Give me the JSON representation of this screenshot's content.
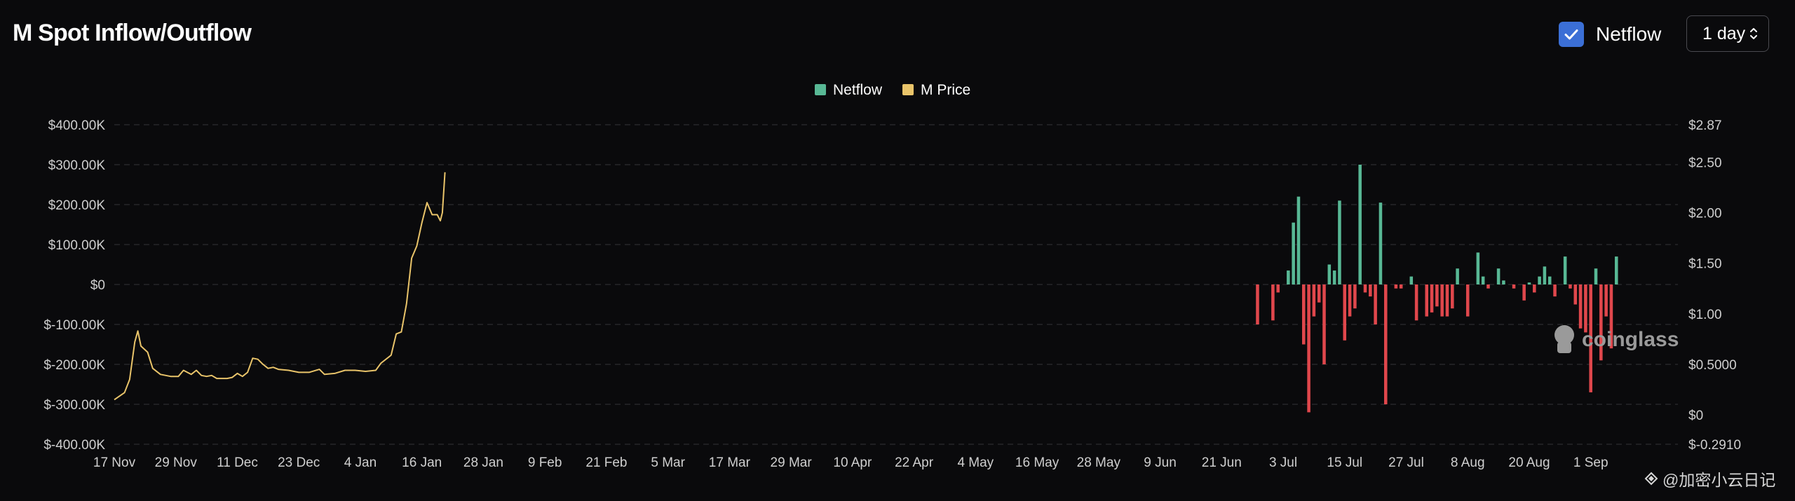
{
  "header": {
    "title": "M Spot Inflow/Outflow",
    "netflow_toggle": {
      "label": "Netflow",
      "checked": true
    },
    "interval_select": {
      "value": "1 day"
    }
  },
  "watermark": {
    "logo_text": "coinglass",
    "source": "@加密小云日记"
  },
  "colors": {
    "background": "#0a0a0c",
    "netflow_positive": "#58b895",
    "netflow_negative": "#e0474c",
    "price": "#e9c46a",
    "grid": "#2c2c30",
    "axis_text": "#cfcfcf"
  },
  "chart_data": {
    "type": "bar",
    "legend": [
      {
        "name": "Netflow",
        "color": "#58b895"
      },
      {
        "name": "M Price",
        "color": "#e9c46a"
      }
    ],
    "legend_position": "top-center",
    "grid": true,
    "y_left": {
      "ticks": [
        "$400.00K",
        "$300.00K",
        "$200.00K",
        "$100.00K",
        "$0",
        "$-100.00K",
        "$-200.00K",
        "$-300.00K",
        "$-400.00K"
      ],
      "range": [
        -400000,
        400000
      ]
    },
    "y_right": {
      "ticks": [
        "$2.87",
        "$2.50",
        "$2.00",
        "$1.50",
        "$1.00",
        "$0.5000",
        "$0",
        "$-0.2910"
      ],
      "tick_values": [
        2.87,
        2.5,
        2.0,
        1.5,
        1.0,
        0.5,
        0,
        -0.291
      ],
      "range": [
        -0.291,
        2.87
      ]
    },
    "x_ticks": [
      "17 Nov",
      "29 Nov",
      "11 Dec",
      "23 Dec",
      "4 Jan",
      "16 Jan",
      "28 Jan",
      "9 Feb",
      "21 Feb",
      "5 Mar",
      "17 Mar",
      "29 Mar",
      "10 Apr",
      "22 Apr",
      "4 May",
      "16 May",
      "28 May",
      "9 Jun",
      "21 Jun",
      "3 Jul",
      "15 Jul",
      "27 Jul",
      "8 Aug",
      "20 Aug",
      "1 Sep"
    ],
    "x_range_days": [
      0,
      305
    ],
    "price_series": {
      "name": "M Price",
      "points": [
        [
          0,
          0.15
        ],
        [
          2,
          0.22
        ],
        [
          3,
          0.35
        ],
        [
          4,
          0.72
        ],
        [
          4.6,
          0.83
        ],
        [
          5.2,
          0.68
        ],
        [
          6.5,
          0.62
        ],
        [
          7.5,
          0.46
        ],
        [
          9,
          0.4
        ],
        [
          11,
          0.38
        ],
        [
          12.5,
          0.38
        ],
        [
          13.5,
          0.44
        ],
        [
          15,
          0.4
        ],
        [
          16,
          0.44
        ],
        [
          17,
          0.39
        ],
        [
          18,
          0.38
        ],
        [
          19,
          0.39
        ],
        [
          20,
          0.36
        ],
        [
          22,
          0.36
        ],
        [
          23,
          0.37
        ],
        [
          24,
          0.41
        ],
        [
          25,
          0.38
        ],
        [
          26,
          0.42
        ],
        [
          27,
          0.56
        ],
        [
          28,
          0.55
        ],
        [
          29,
          0.5
        ],
        [
          30,
          0.46
        ],
        [
          31,
          0.47
        ],
        [
          32,
          0.45
        ],
        [
          34,
          0.44
        ],
        [
          36,
          0.42
        ],
        [
          38,
          0.42
        ],
        [
          40,
          0.45
        ],
        [
          41,
          0.4
        ],
        [
          43,
          0.41
        ],
        [
          45,
          0.44
        ],
        [
          47,
          0.44
        ],
        [
          49,
          0.43
        ],
        [
          51,
          0.44
        ],
        [
          52,
          0.51
        ],
        [
          54,
          0.59
        ],
        [
          55,
          0.8
        ],
        [
          56,
          0.82
        ],
        [
          57,
          1.1
        ],
        [
          58,
          1.55
        ],
        [
          59,
          1.67
        ],
        [
          60,
          1.9
        ],
        [
          61,
          2.1
        ],
        [
          62,
          1.98
        ],
        [
          63,
          1.98
        ],
        [
          63.6,
          1.92
        ],
        [
          64,
          2.0
        ],
        [
          64.5,
          2.4
        ]
      ]
    },
    "netflow_series": {
      "name": "Netflow",
      "points": [
        [
          223,
          -100000
        ],
        [
          226,
          -90000
        ],
        [
          227,
          -20000
        ],
        [
          229,
          35000
        ],
        [
          230,
          155000
        ],
        [
          231,
          220000
        ],
        [
          232,
          -150000
        ],
        [
          233,
          -320000
        ],
        [
          234,
          -80000
        ],
        [
          235,
          -45000
        ],
        [
          236,
          -200000
        ],
        [
          237,
          50000
        ],
        [
          238,
          35000
        ],
        [
          239,
          210000
        ],
        [
          240,
          -140000
        ],
        [
          241,
          -80000
        ],
        [
          242,
          -60000
        ],
        [
          243,
          300000
        ],
        [
          244,
          -20000
        ],
        [
          245,
          -30000
        ],
        [
          246,
          -100000
        ],
        [
          247,
          205000
        ],
        [
          248,
          -300000
        ],
        [
          250,
          -10000
        ],
        [
          251,
          -10000
        ],
        [
          253,
          20000
        ],
        [
          254,
          -90000
        ],
        [
          256,
          -80000
        ],
        [
          257,
          -70000
        ],
        [
          258,
          -55000
        ],
        [
          259,
          -80000
        ],
        [
          260,
          -80000
        ],
        [
          261,
          -60000
        ],
        [
          262,
          40000
        ],
        [
          264,
          -80000
        ],
        [
          266,
          80000
        ],
        [
          267,
          20000
        ],
        [
          268,
          -10000
        ],
        [
          270,
          40000
        ],
        [
          271,
          10000
        ],
        [
          273,
          -10000
        ],
        [
          275,
          -40000
        ],
        [
          276,
          5000
        ],
        [
          277,
          -20000
        ],
        [
          278,
          20000
        ],
        [
          279,
          45000
        ],
        [
          280,
          20000
        ],
        [
          281,
          -30000
        ],
        [
          283,
          70000
        ],
        [
          284,
          -10000
        ],
        [
          285,
          -50000
        ],
        [
          286,
          -110000
        ],
        [
          287,
          -120000
        ],
        [
          288,
          -270000
        ],
        [
          289,
          40000
        ],
        [
          290,
          -190000
        ],
        [
          291,
          -80000
        ],
        [
          292,
          -160000
        ],
        [
          293,
          70000
        ]
      ]
    }
  }
}
